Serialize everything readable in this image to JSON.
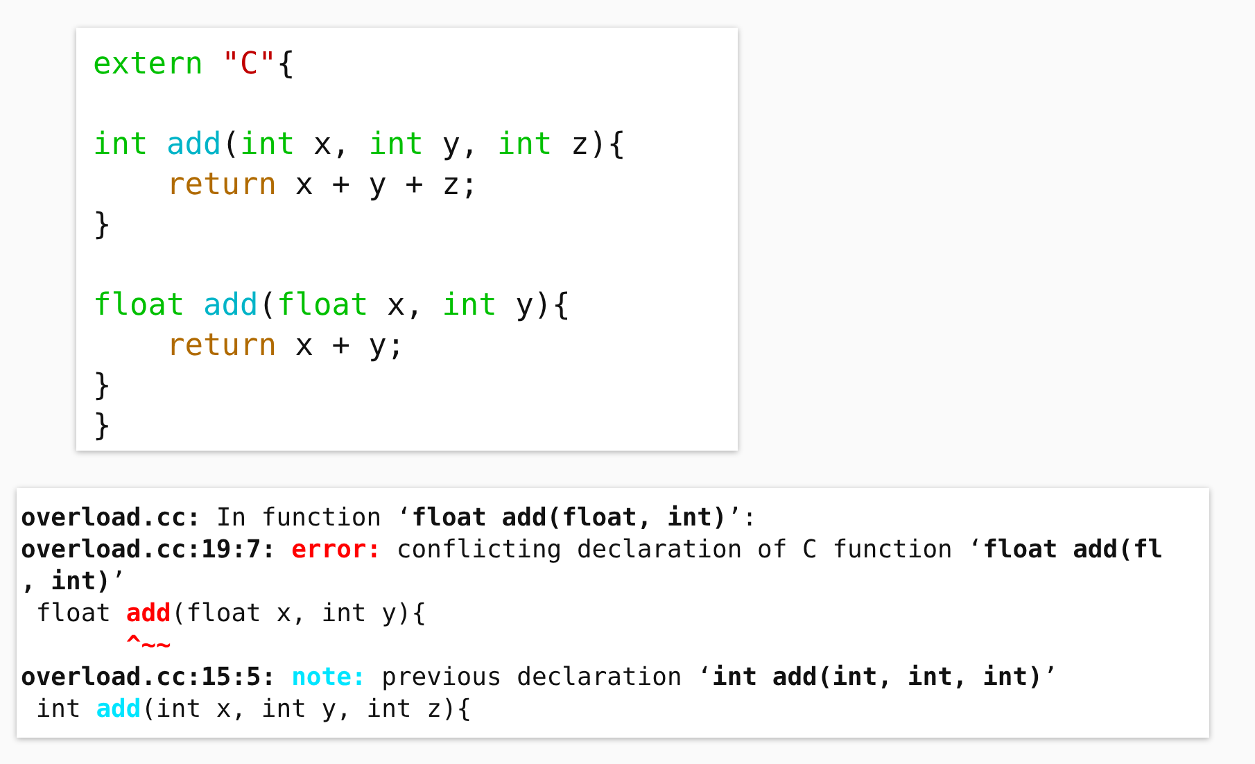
{
  "code_panel": {
    "blocks": [
      [
        [
          {
            "kind": "keyword",
            "text": "extern"
          },
          {
            "kind": "string",
            "text": " \"C\""
          },
          {
            "kind": "plain",
            "text": "{"
          }
        ]
      ],
      [
        [
          {
            "kind": "keyword",
            "text": "int"
          },
          {
            "kind": "function",
            "text": " add"
          },
          {
            "kind": "plain",
            "text": "("
          },
          {
            "kind": "keyword",
            "text": "int"
          },
          {
            "kind": "plain",
            "text": " x, "
          },
          {
            "kind": "keyword",
            "text": "int"
          },
          {
            "kind": "plain",
            "text": " y, "
          },
          {
            "kind": "keyword",
            "text": "int"
          },
          {
            "kind": "plain",
            "text": " z){"
          }
        ],
        [
          {
            "kind": "statement",
            "text": "    return"
          },
          {
            "kind": "plain",
            "text": " x + y + z;"
          }
        ],
        [
          {
            "kind": "plain",
            "text": "}"
          }
        ]
      ],
      [
        [
          {
            "kind": "keyword",
            "text": "float"
          },
          {
            "kind": "function",
            "text": " add"
          },
          {
            "kind": "plain",
            "text": "("
          },
          {
            "kind": "keyword",
            "text": "float"
          },
          {
            "kind": "plain",
            "text": " x, "
          },
          {
            "kind": "keyword",
            "text": "int"
          },
          {
            "kind": "plain",
            "text": " y){"
          }
        ],
        [
          {
            "kind": "statement",
            "text": "    return"
          },
          {
            "kind": "plain",
            "text": " x + y;"
          }
        ],
        [
          {
            "kind": "plain",
            "text": "}"
          }
        ],
        [
          {
            "kind": "plain",
            "text": "}"
          }
        ]
      ]
    ]
  },
  "terminal": {
    "lines": [
      [
        {
          "kind": "bold",
          "text": "overload.cc:"
        },
        {
          "kind": "plain",
          "text": " In function ‘"
        },
        {
          "kind": "bold",
          "text": "float add(float, int)"
        },
        {
          "kind": "plain",
          "text": "’:"
        }
      ],
      [
        {
          "kind": "bold",
          "text": "overload.cc:19:7:"
        },
        {
          "kind": "error",
          "text": " error:"
        },
        {
          "kind": "plain",
          "text": " conflicting declaration of C function ‘"
        },
        {
          "kind": "bold",
          "text": "float add(fl"
        }
      ],
      [
        {
          "kind": "bold",
          "text": ", int)"
        },
        {
          "kind": "plain",
          "text": "’"
        }
      ],
      [
        {
          "kind": "plain",
          "text": " float "
        },
        {
          "kind": "error",
          "text": "add"
        },
        {
          "kind": "plain",
          "text": "(float x, int y){"
        }
      ],
      [
        {
          "kind": "error",
          "text": "       ^~~"
        }
      ],
      [
        {
          "kind": "bold",
          "text": "overload.cc:15:5:"
        },
        {
          "kind": "note",
          "text": " note:"
        },
        {
          "kind": "plain",
          "text": " previous declaration ‘"
        },
        {
          "kind": "bold",
          "text": "int add(int, int, int)"
        },
        {
          "kind": "plain",
          "text": "’"
        }
      ],
      [
        {
          "kind": "plain",
          "text": " int "
        },
        {
          "kind": "note",
          "text": "add"
        },
        {
          "kind": "plain",
          "text": "(int x, int y, int z){"
        }
      ]
    ]
  }
}
